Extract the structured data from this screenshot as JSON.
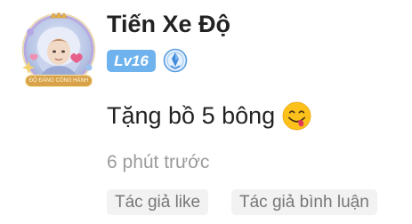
{
  "user": {
    "name": "Tiến Xe Độ",
    "level": "Lv16",
    "frame_caption": "ĐỘ ĐĂNG CÔNG HÀNH"
  },
  "comment": {
    "text": "Tặng bồ 5 bông",
    "emoji": "face-savoring-food-icon"
  },
  "meta": {
    "time": "6 phút trước"
  },
  "tags": {
    "author_like": "Tác giả like",
    "author_reply": "Tác giả bình luận"
  },
  "colors": {
    "level_badge": "#6fb3ee",
    "tag_bg": "#f2f2f2",
    "muted_text": "#9b9b9b",
    "frame_gold": "#d8a24a"
  }
}
